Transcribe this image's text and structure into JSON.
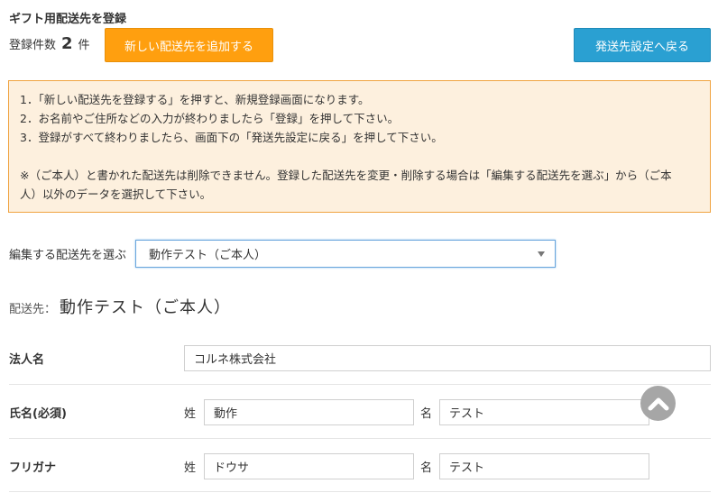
{
  "header": {
    "title": "ギフト用配送先を登録",
    "count_label": "登録件数",
    "count_value": "2",
    "count_unit": "件",
    "add_button": "新しい配送先を追加する",
    "back_button": "発送先設定へ戻る"
  },
  "notice": {
    "line1": "1．「新しい配送先を登録する」を押すと、新規登録画面になります。",
    "line2": "2．お名前やご住所などの入力が終わりましたら「登録」を押して下さい。",
    "line3": "3．登録がすべて終わりましたら、画面下の「発送先設定に戻る」を押して下さい。",
    "line4": "※（ご本人）と書かれた配送先は削除できません。登録した配送先を変更・削除する場合は「編集する配送先を選ぶ」から（ご本",
    "line5": "人）以外のデータを選択して下さい。"
  },
  "selector": {
    "label": "編集する配送先を選ぶ",
    "selected": "動作テスト（ご本人）"
  },
  "destination": {
    "prefix": "配送先：",
    "name": "動作テスト（ご本人）"
  },
  "form": {
    "corp": {
      "label": "法人名",
      "value": "コルネ株式会社"
    },
    "name": {
      "label": "氏名(必須)",
      "sei_label": "姓",
      "sei_value": "動作",
      "mei_label": "名",
      "mei_value": "テスト"
    },
    "kana": {
      "label": "フリガナ",
      "sei_label": "姓",
      "sei_value": "ドウサ",
      "mei_label": "名",
      "mei_value": "テスト"
    }
  },
  "colors": {
    "add_button": "#ff9f0f",
    "back_button": "#2aa0d2",
    "notice_bg": "#fdf0de",
    "notice_border": "#f0a340"
  },
  "icons": {
    "scroll_top": "chevron-up-icon"
  }
}
